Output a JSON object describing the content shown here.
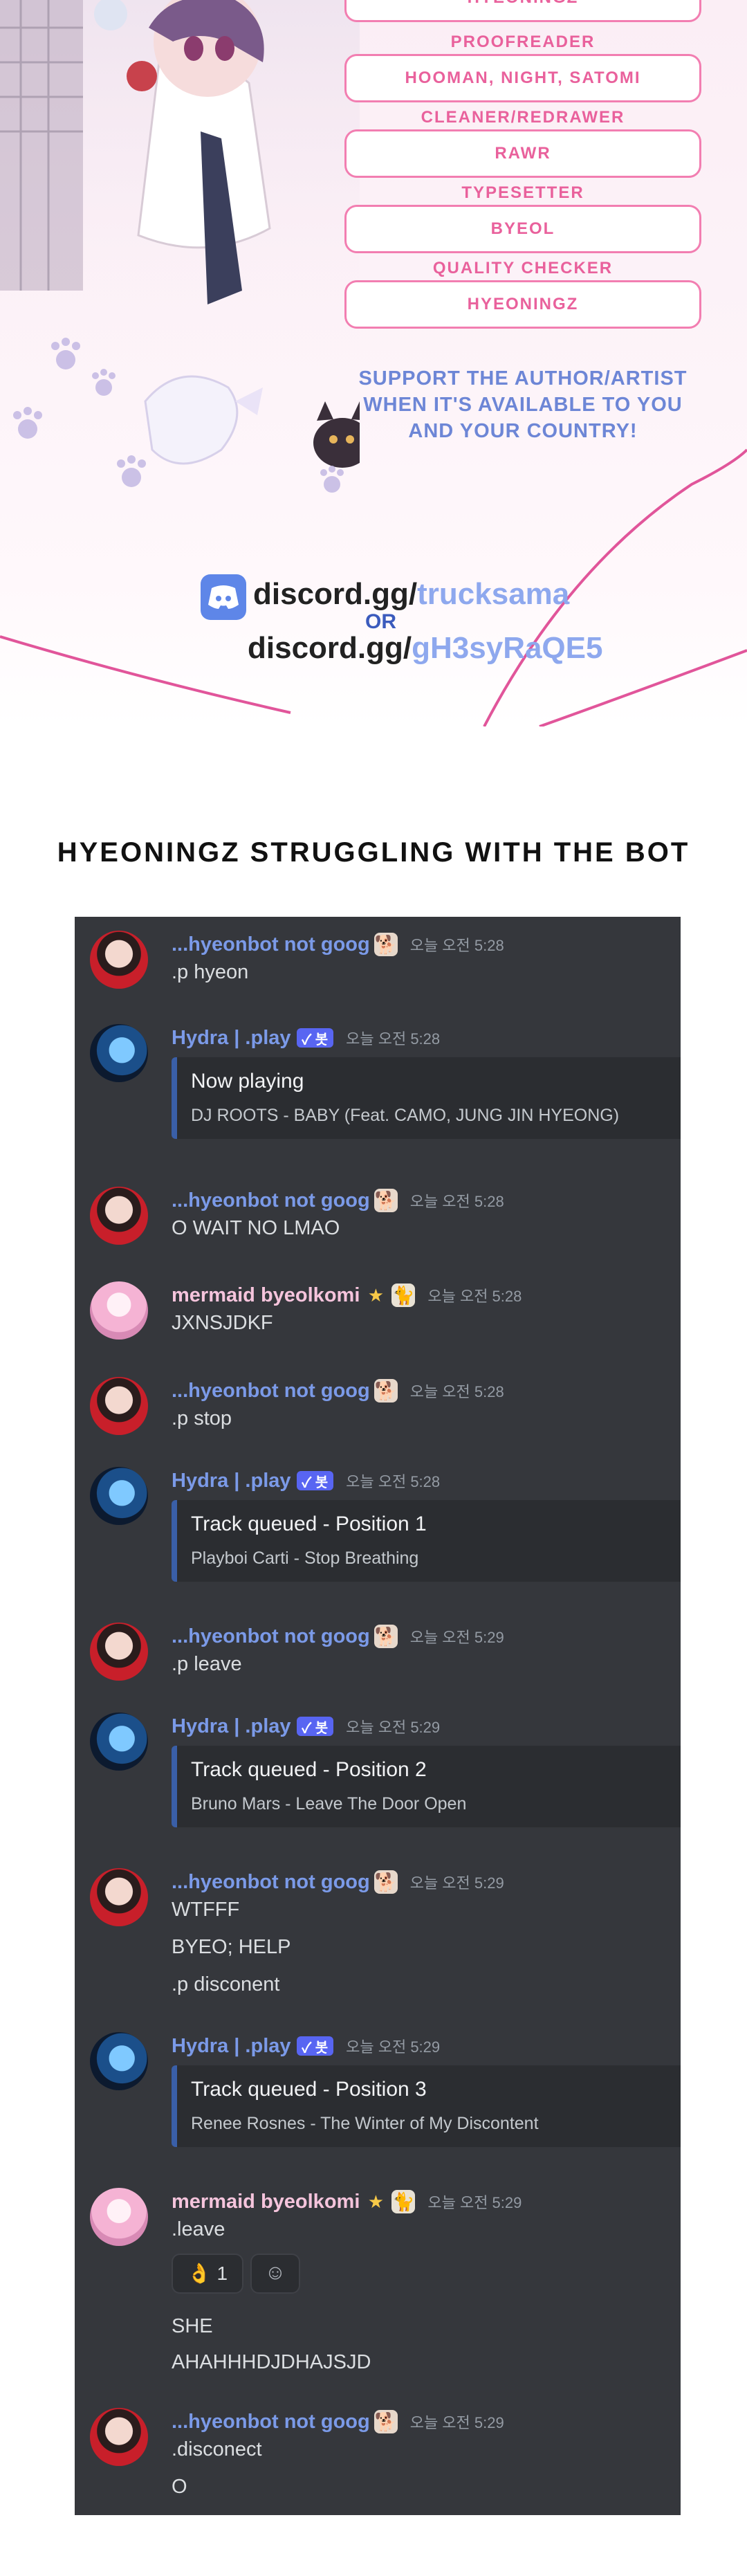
{
  "credits": [
    {
      "role": "PROOFREADER",
      "value": "HOOMAN, NIGHT, SATOMI"
    },
    {
      "role": "CLEANER/REDRAWER",
      "value": "RAWR"
    },
    {
      "role": "TYPESETTER",
      "value": "BYEOL"
    },
    {
      "role": "QUALITY CHECKER",
      "value": "HYEONINGZ"
    }
  ],
  "top_partial_value": "HYEONINGZ",
  "support_lines": [
    "SUPPORT THE AUTHOR/ARTIST",
    "WHEN IT'S AVAILABLE TO YOU",
    "AND YOUR COUNTRY!"
  ],
  "discord": {
    "link1_prefix": "discord.gg/",
    "link1_code": "trucksama",
    "or": "OR",
    "link2_prefix": "discord.gg/",
    "link2_code": "gH3syRaQE5"
  },
  "heading": "HYEONINGZ STRUGGLING WITH THE BOT",
  "chat": {
    "users": {
      "hyeon": "...hyeonbot not goog",
      "hydra": "Hydra | .play",
      "byeol": "mermaid byeolkomi"
    },
    "bot_badge": "✓ 봇",
    "messages": [
      {
        "time": "오늘 오전 5:28",
        "lines": [
          ".p hyeon"
        ]
      },
      {
        "time": "오늘 오전 5:28",
        "embed_title": "Now playing",
        "embed_sub": "DJ ROOTS - BABY (Feat. CAMO, JUNG JIN HYEONG)"
      },
      {
        "time": "오늘 오전 5:28",
        "lines": [
          "O WAIT NO LMAO"
        ]
      },
      {
        "time": "오늘 오전 5:28",
        "lines": [
          "JXNSJDKF"
        ]
      },
      {
        "time": "오늘 오전 5:28",
        "lines": [
          ".p stop"
        ]
      },
      {
        "time": "오늘 오전 5:28",
        "embed_title": "Track queued - Position 1",
        "embed_sub": "Playboi Carti - Stop Breathing"
      },
      {
        "time": "오늘 오전 5:29",
        "lines": [
          ".p leave"
        ]
      },
      {
        "time": "오늘 오전 5:29",
        "embed_title": "Track queued - Position 2",
        "embed_sub": "Bruno Mars - Leave The Door Open"
      },
      {
        "time": "오늘 오전 5:29",
        "lines": [
          "WTFFF",
          "BYEO; HELP",
          ".p disconent"
        ]
      },
      {
        "time": "오늘 오전 5:29",
        "embed_title": "Track queued - Position 3",
        "embed_sub": "Renee Rosnes - The Winter of My Discontent"
      },
      {
        "time": "오늘 오전 5:29",
        "lines": [
          ".leave",
          "SHE",
          "AHAHHHDJDHAJSJD"
        ],
        "reaction": "👌 1"
      },
      {
        "time": "오늘 오전 5:29",
        "lines": [
          ".disconect",
          "O"
        ]
      }
    ]
  }
}
